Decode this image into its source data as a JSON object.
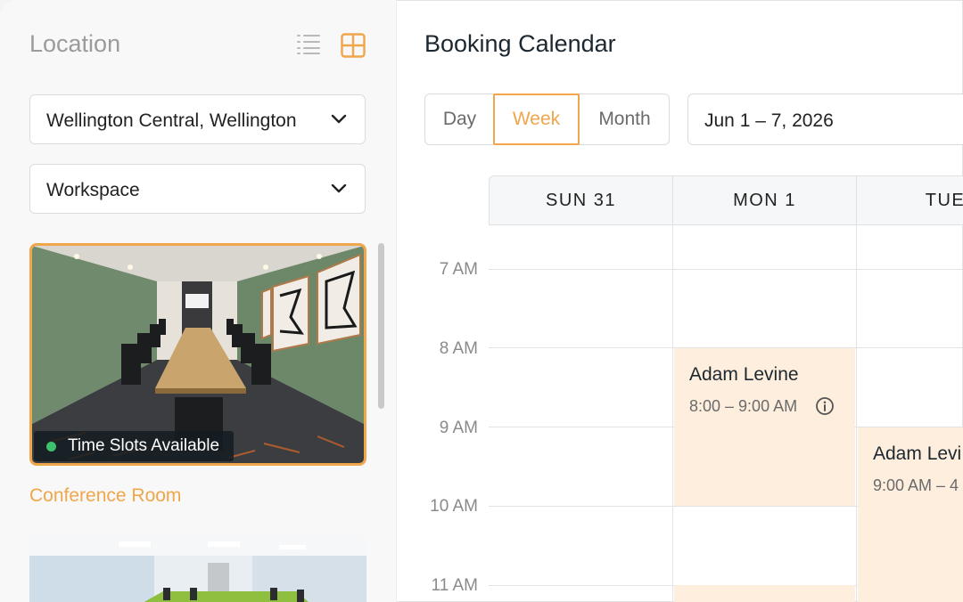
{
  "sidebar": {
    "title": "Location",
    "location_select": {
      "value": "Wellington Central, Wellington"
    },
    "type_select": {
      "value": "Workspace"
    },
    "rooms": [
      {
        "name": "Conference Room",
        "status": "Time Slots Available",
        "status_color": "#3ec16b",
        "selected": true
      },
      {
        "name": "",
        "status": "",
        "selected": false
      }
    ],
    "icons": {
      "list_view": "list-icon",
      "grid_view": "grid-icon",
      "chevron": "chevron-down-icon"
    }
  },
  "main": {
    "title": "Booking Calendar",
    "view_tabs": [
      {
        "label": "Day",
        "active": false
      },
      {
        "label": "Week",
        "active": true
      },
      {
        "label": "Month",
        "active": false
      }
    ],
    "date_range": "Jun 1 – 7, 2026",
    "columns": [
      "SUN 31",
      "MON 1",
      "TUE"
    ],
    "times": [
      "7 AM",
      "8 AM",
      "9 AM",
      "10 AM",
      "11 AM"
    ],
    "events": [
      {
        "name": "Adam Levine",
        "time": "8:00 – 9:00 AM",
        "day": "MON 1"
      },
      {
        "name": "Adam Levi",
        "time": "9:00 AM – 4",
        "day": "TUE"
      },
      {
        "name": "",
        "time": "",
        "day": "MON 1"
      }
    ]
  },
  "colors": {
    "accent": "#f0a64a",
    "event_bg": "#fdeedd",
    "available": "#3ec16b",
    "heading": "#1d2730"
  }
}
